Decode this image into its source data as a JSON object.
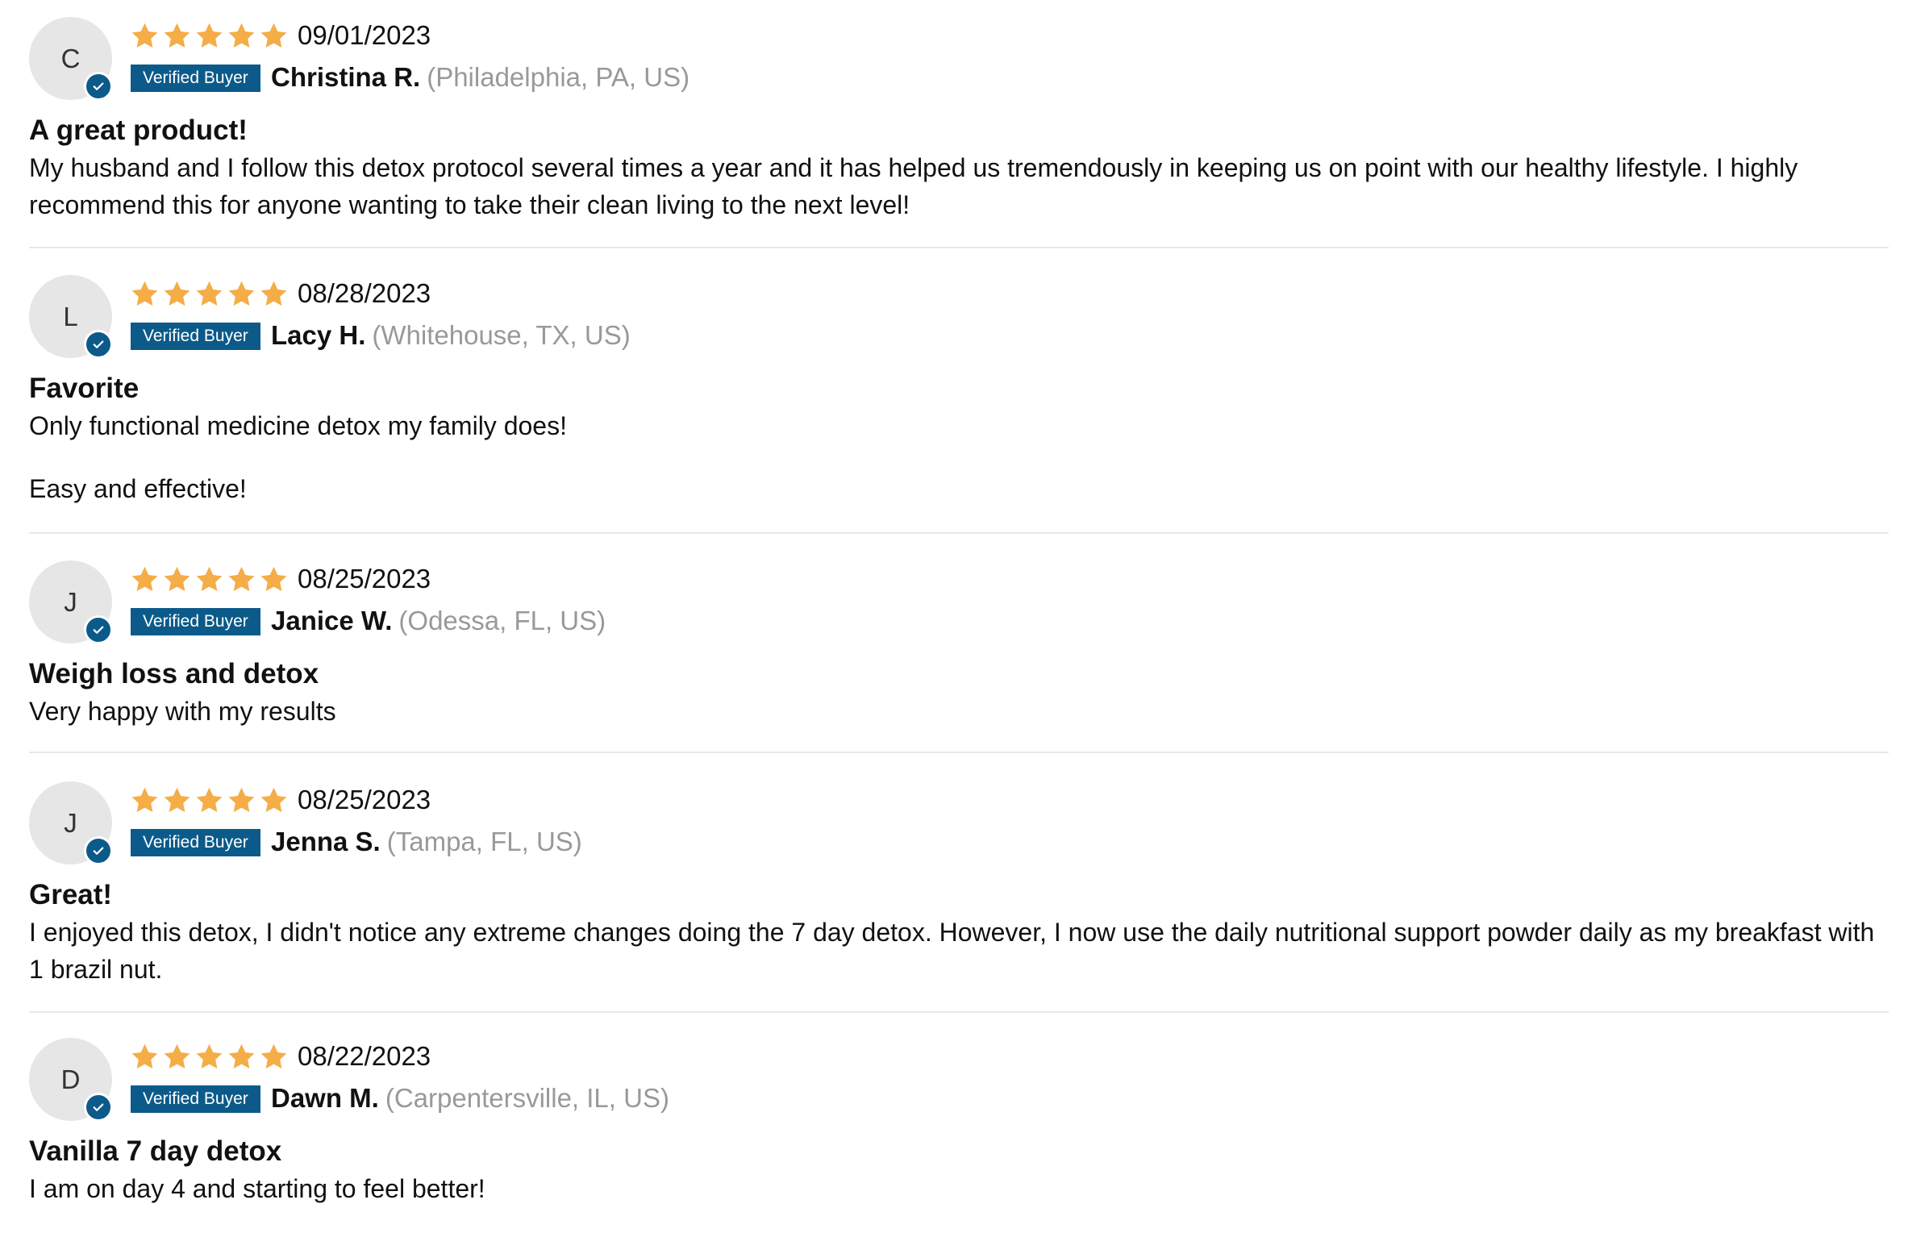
{
  "colors": {
    "star": "#f4ad47",
    "badge_bg": "#0b5a8a",
    "location": "#999999",
    "avatar_bg": "#e6e6e6",
    "divider": "#e8e8e8"
  },
  "badge_label": "Verified Buyer",
  "reviews": [
    {
      "initial": "C",
      "rating": 5,
      "date": "09/01/2023",
      "badge": "Verified Buyer",
      "name": "Christina R.",
      "location": "(Philadelphia, PA, US)",
      "title": "A great product!",
      "body": [
        "My husband and I follow this detox protocol several times a year and it has helped us tremendously in keeping us on point with our healthy lifestyle. I highly recommend this for anyone wanting to take their clean living to the next level!"
      ]
    },
    {
      "initial": "L",
      "rating": 5,
      "date": "08/28/2023",
      "badge": "Verified Buyer",
      "name": "Lacy H.",
      "location": "(Whitehouse, TX, US)",
      "title": "Favorite",
      "body": [
        "Only functional medicine detox my family does!",
        "Easy and effective!"
      ]
    },
    {
      "initial": "J",
      "rating": 5,
      "date": "08/25/2023",
      "badge": "Verified Buyer",
      "name": "Janice W.",
      "location": "(Odessa, FL, US)",
      "title": "Weigh loss and detox",
      "body": [
        "Very happy with my results"
      ]
    },
    {
      "initial": "J",
      "rating": 5,
      "date": "08/25/2023",
      "badge": "Verified Buyer",
      "name": "Jenna S.",
      "location": "(Tampa, FL, US)",
      "title": "Great!",
      "body": [
        "I enjoyed this detox, I didn't notice any extreme changes doing the 7 day detox. However, I now use the daily nutritional support powder daily as my breakfast with 1 brazil nut."
      ]
    },
    {
      "initial": "D",
      "rating": 5,
      "date": "08/22/2023",
      "badge": "Verified Buyer",
      "name": "Dawn M.",
      "location": "(Carpentersville, IL, US)",
      "title": "Vanilla 7 day detox",
      "body": [
        "I am on day 4 and starting to feel better!"
      ]
    }
  ]
}
